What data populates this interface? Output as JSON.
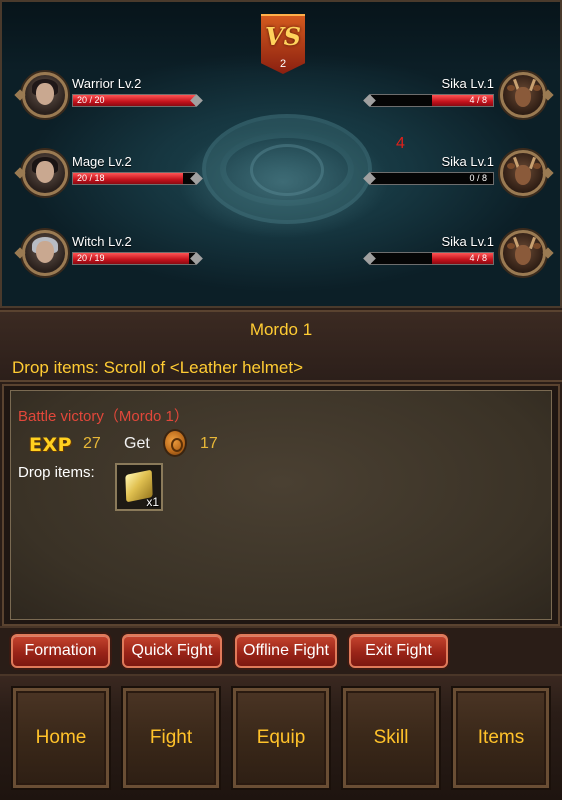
{
  "battle": {
    "round": "2",
    "vs_label": "VS",
    "damage_popup": "4",
    "allies": [
      {
        "name": "Warrior Lv.2",
        "hp_text": "20 / 20",
        "hp_fraction": 1.0
      },
      {
        "name": "Mage Lv.2",
        "hp_text": "20 / 18",
        "hp_fraction": 0.9
      },
      {
        "name": "Witch Lv.2",
        "hp_text": "20 / 19",
        "hp_fraction": 0.95
      }
    ],
    "enemies": [
      {
        "name": "Sika Lv.1",
        "hp_text": "4 / 8",
        "hp_fraction": 0.5
      },
      {
        "name": "Sika Lv.1",
        "hp_text": "0 / 8",
        "hp_fraction": 0.0
      },
      {
        "name": "Sika Lv.1",
        "hp_text": "4 / 8",
        "hp_fraction": 0.5
      }
    ]
  },
  "stage": {
    "title": "Mordo 1",
    "drop_info": "Drop items: Scroll of <Leather helmet>"
  },
  "result": {
    "victory_text": "Battle victory（Mordo 1）",
    "exp_label": "EXP",
    "exp_value": "27",
    "get_label": "Get",
    "gold_value": "17",
    "drop_label": "Drop items:",
    "drop_item_qty": "x1"
  },
  "actions": {
    "formation": "Formation",
    "quick_fight": "Quick Fight",
    "offline_fight": "Offline Fight",
    "exit_fight": "Exit Fight"
  },
  "nav": {
    "home": "Home",
    "fight": "Fight",
    "equip": "Equip",
    "skill": "Skill",
    "items": "Items"
  },
  "colors": {
    "accent_gold": "#ffcc33",
    "victory_red": "#e2473a",
    "hp_red": "#c4121c",
    "button_red": "#9a2418"
  },
  "icons": {
    "vs": "vs-banner-icon",
    "coin": "gold-coin-icon",
    "exp": "exp-icon",
    "drop": "scroll-icon"
  }
}
